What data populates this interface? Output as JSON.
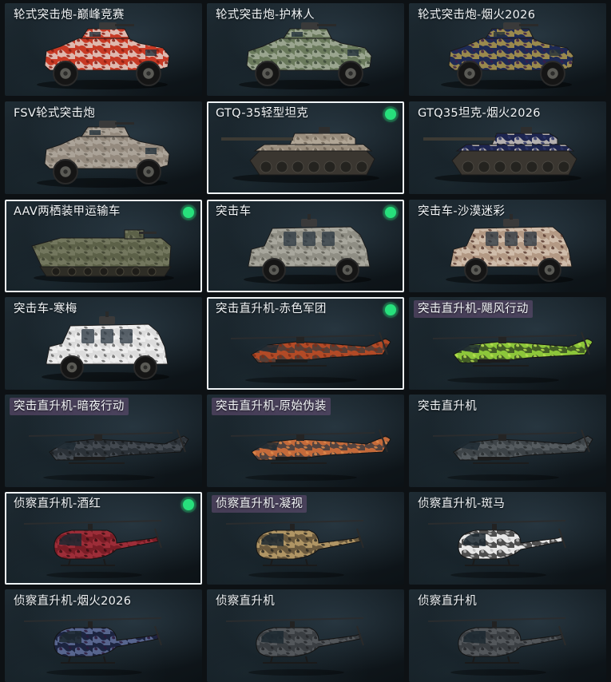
{
  "colors": {
    "selected_border": "#eef3f5",
    "equipped_badge": "#27e07c",
    "tinted_label_bg": "#69507899"
  },
  "grid": {
    "cards": [
      {
        "label": "轮式突击炮-巅峰竞赛",
        "icon": "armored-car-icon",
        "camo": [
          "#c83a25",
          "#e6e1dc",
          "#8a1c10"
        ],
        "selected": false,
        "equipped": false,
        "tinted": false
      },
      {
        "label": "轮式突击炮-护林人",
        "icon": "armored-car-icon",
        "camo": [
          "#6a7a5c",
          "#a9b2a0",
          "#3d4a38"
        ],
        "selected": false,
        "equipped": false,
        "tinted": false
      },
      {
        "label": "轮式突击炮-烟火2026",
        "icon": "armored-car-icon",
        "camo": [
          "#1e2a55",
          "#c2a84a",
          "#3a1f4a"
        ],
        "selected": false,
        "equipped": false,
        "tinted": false
      },
      {
        "label": "FSV轮式突击炮",
        "icon": "armored-car-icon",
        "camo": [
          "#948a7e",
          "#b3aba0",
          "#6e675d"
        ],
        "selected": false,
        "equipped": false,
        "tinted": false
      },
      {
        "label": "GTQ-35轻型坦克",
        "icon": "tank-icon",
        "camo": [
          "#9a8e7e",
          "#b8ad9d",
          "#6e6457"
        ],
        "selected": true,
        "equipped": true,
        "tinted": false
      },
      {
        "label": "GTQ35坦克-烟火2026",
        "icon": "tank-icon",
        "camo": [
          "#1d2550",
          "#e7dfd0",
          "#2c3468"
        ],
        "selected": false,
        "equipped": false,
        "tinted": false
      },
      {
        "label": "AAV两栖装甲运输车",
        "icon": "amphibious-carrier-icon",
        "camo": [
          "#5c6148",
          "#7b7f65",
          "#3f4331"
        ],
        "selected": true,
        "equipped": true,
        "tinted": false
      },
      {
        "label": "突击车",
        "icon": "assault-vehicle-icon",
        "camo": [
          "#8f8e84",
          "#b0afa5",
          "#5e5d55"
        ],
        "selected": true,
        "equipped": true,
        "tinted": false
      },
      {
        "label": "突击车-沙漠迷彩",
        "icon": "assault-vehicle-icon",
        "camo": [
          "#b39984",
          "#d8c8b6",
          "#5c3d33"
        ],
        "selected": false,
        "equipped": false,
        "tinted": false
      },
      {
        "label": "突击车-寒梅",
        "icon": "assault-vehicle-icon",
        "camo": [
          "#dcdcdc",
          "#f4f4f4",
          "#6b6b6b"
        ],
        "selected": false,
        "equipped": false,
        "tinted": false
      },
      {
        "label": "突击直升机-赤色军团",
        "icon": "attack-helicopter-icon",
        "camo": [
          "#b24a26",
          "#3a3a3a",
          "#7e2e18"
        ],
        "selected": true,
        "equipped": true,
        "tinted": false
      },
      {
        "label": "突击直升机-飓风行动",
        "icon": "attack-helicopter-icon",
        "camo": [
          "#8cc63a",
          "#2b3a1e",
          "#b7e050"
        ],
        "selected": false,
        "equipped": false,
        "tinted": true
      },
      {
        "label": "突击直升机-暗夜行动",
        "icon": "attack-helicopter-icon",
        "camo": [
          "#2c3238",
          "#4a5058",
          "#1a1e22"
        ],
        "selected": false,
        "equipped": false,
        "tinted": true
      },
      {
        "label": "突击直升机-原始伪装",
        "icon": "attack-helicopter-icon",
        "camo": [
          "#c46a3a",
          "#2d3540",
          "#e08a4a"
        ],
        "selected": false,
        "equipped": false,
        "tinted": true
      },
      {
        "label": "突击直升机",
        "icon": "attack-helicopter-icon",
        "camo": [
          "#3e4448",
          "#5c6266",
          "#272b2e"
        ],
        "selected": false,
        "equipped": false,
        "tinted": false
      },
      {
        "label": "侦察直升机-酒红",
        "icon": "scout-helicopter-icon",
        "camo": [
          "#7a1d26",
          "#a8323d",
          "#3a0e12"
        ],
        "selected": true,
        "equipped": true,
        "tinted": false
      },
      {
        "label": "侦察直升机-凝视",
        "icon": "scout-helicopter-icon",
        "camo": [
          "#6b5a3e",
          "#c6a870",
          "#2e2a22"
        ],
        "selected": false,
        "equipped": false,
        "tinted": true
      },
      {
        "label": "侦察直升机-斑马",
        "icon": "scout-helicopter-icon",
        "camo": [
          "#e8e8e8",
          "#1a1a1a",
          "#bcbcbc"
        ],
        "selected": false,
        "equipped": false,
        "tinted": false
      },
      {
        "label": "侦察直升机-烟火2026",
        "icon": "scout-helicopter-icon",
        "camo": [
          "#1c2440",
          "#6a7aa8",
          "#2c1a3a"
        ],
        "selected": false,
        "equipped": false,
        "tinted": false
      },
      {
        "label": "侦察直升机",
        "icon": "scout-helicopter-icon",
        "camo": [
          "#3a3e42",
          "#5a5e62",
          "#24272a"
        ],
        "selected": false,
        "equipped": false,
        "tinted": false
      },
      {
        "label": "侦察直升机",
        "icon": "scout-helicopter-icon",
        "camo": [
          "#3a3e42",
          "#5a5e62",
          "#24272a"
        ],
        "selected": false,
        "equipped": false,
        "tinted": false
      }
    ]
  }
}
